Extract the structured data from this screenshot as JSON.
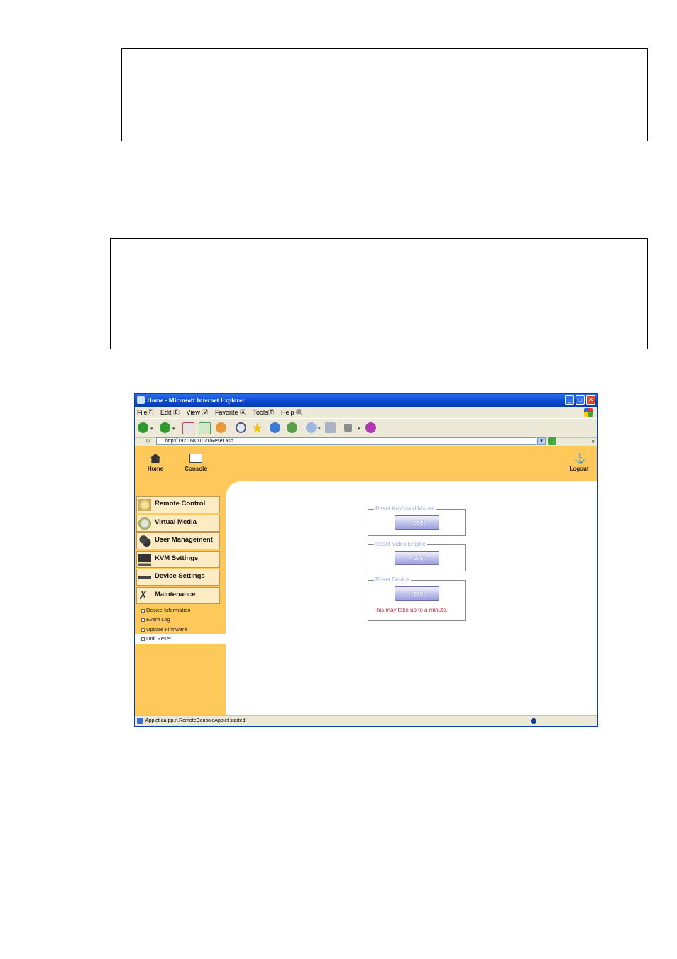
{
  "window": {
    "title": "Home - Microsoft Internet Explorer",
    "menu": [
      "FileⒻ",
      "Edit Ⓔ",
      "View Ⓥ",
      "Favorite Ⓐ",
      "ToolsⓉ",
      "Help Ⓗ"
    ],
    "address": "http://192.168.10.21/Reset.asp",
    "status": "Applet aa.pp.n.RemoteConsoleApplet started"
  },
  "header": {
    "home_label": "Home",
    "console_label": "Console",
    "logout_label": "Logout"
  },
  "sidebar": {
    "items": [
      {
        "label": "Remote Control",
        "icon": "remote-control-icon"
      },
      {
        "label": "Virtual Media",
        "icon": "virtual-media-icon"
      },
      {
        "label": "User Management",
        "icon": "user-management-icon"
      },
      {
        "label": "KVM Settings",
        "icon": "kvm-settings-icon"
      },
      {
        "label": "Device Settings",
        "icon": "device-settings-icon"
      },
      {
        "label": "Maintenance",
        "icon": "maintenance-icon"
      }
    ],
    "subitems": [
      "Device Information",
      "Event Log",
      "Update Firmware",
      "Unit Reset"
    ],
    "active_subitem": "Unit Reset"
  },
  "main": {
    "groups": [
      {
        "legend": "Reset Keyboard/Mouse",
        "button": "Reset"
      },
      {
        "legend": "Reset Video Engine",
        "button": "Reset"
      },
      {
        "legend": "Reset Device",
        "button": "Reset",
        "note": "This may take up to a minute."
      }
    ]
  },
  "colors": {
    "page_bg": "#ffc85a",
    "legend": "#9fa8e6",
    "warning": "#c0243e",
    "title_bar": "#0b48d0"
  }
}
